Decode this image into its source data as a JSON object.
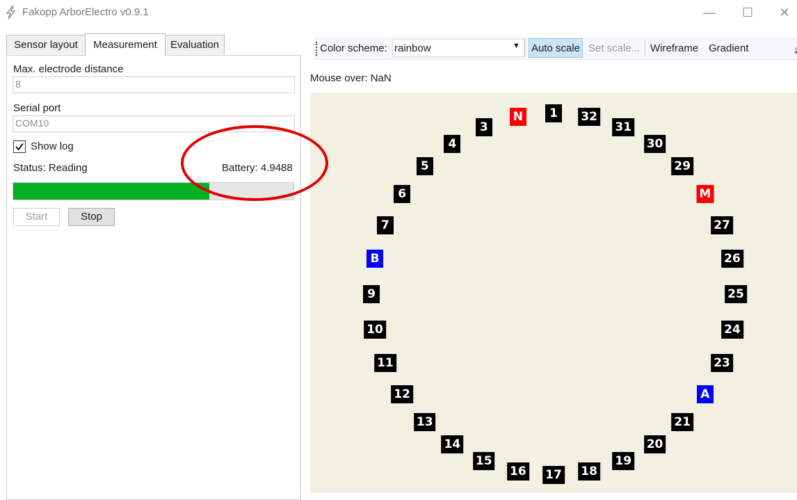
{
  "window": {
    "title": "Fakopp ArborElectro v0.9.1",
    "app_icon": "lightning-icon",
    "controls": {
      "minimize": "—",
      "maximize": "☐",
      "close": "✕"
    }
  },
  "tabs": [
    {
      "label": "Sensor layout",
      "active": false
    },
    {
      "label": "Measurement",
      "active": true
    },
    {
      "label": "Evaluation",
      "active": false
    }
  ],
  "measurement": {
    "max_distance_label": "Max. electrode distance",
    "max_distance_value": "8",
    "serial_port_label": "Serial port",
    "serial_port_value": "COM10",
    "show_log_label": "Show log",
    "show_log_checked": true,
    "status_text": "Status: Reading",
    "battery_text": "Battery: 4.9488",
    "progress_fraction": 0.7,
    "progress_color": "#06b025",
    "start_label": "Start",
    "stop_label": "Stop"
  },
  "toolbar": {
    "color_scheme_label": "Color scheme:",
    "color_scheme_value": "rainbow",
    "auto_scale": "Auto scale",
    "set_scale": "Set scale...",
    "wireframe": "Wireframe",
    "gradient": "Gradient"
  },
  "mouse_over": "Mouse over: NaN",
  "annotation_color": "#e00000",
  "plot_background": "#f2f0e0",
  "electrodes": [
    {
      "label": "1",
      "color": "black"
    },
    {
      "label": "32",
      "color": "black"
    },
    {
      "label": "31",
      "color": "black"
    },
    {
      "label": "30",
      "color": "black"
    },
    {
      "label": "29",
      "color": "black"
    },
    {
      "label": "M",
      "color": "red"
    },
    {
      "label": "27",
      "color": "black"
    },
    {
      "label": "26",
      "color": "black"
    },
    {
      "label": "25",
      "color": "black"
    },
    {
      "label": "24",
      "color": "black"
    },
    {
      "label": "23",
      "color": "black"
    },
    {
      "label": "A",
      "color": "blue"
    },
    {
      "label": "21",
      "color": "black"
    },
    {
      "label": "20",
      "color": "black"
    },
    {
      "label": "19",
      "color": "black"
    },
    {
      "label": "18",
      "color": "black"
    },
    {
      "label": "17",
      "color": "black"
    },
    {
      "label": "16",
      "color": "black"
    },
    {
      "label": "15",
      "color": "black"
    },
    {
      "label": "14",
      "color": "black"
    },
    {
      "label": "13",
      "color": "black"
    },
    {
      "label": "12",
      "color": "black"
    },
    {
      "label": "11",
      "color": "black"
    },
    {
      "label": "10",
      "color": "black"
    },
    {
      "label": "9",
      "color": "black"
    },
    {
      "label": "B",
      "color": "blue"
    },
    {
      "label": "7",
      "color": "black"
    },
    {
      "label": "6",
      "color": "black"
    },
    {
      "label": "5",
      "color": "black"
    },
    {
      "label": "4",
      "color": "black"
    },
    {
      "label": "3",
      "color": "black"
    },
    {
      "label": "N",
      "color": "red"
    }
  ]
}
